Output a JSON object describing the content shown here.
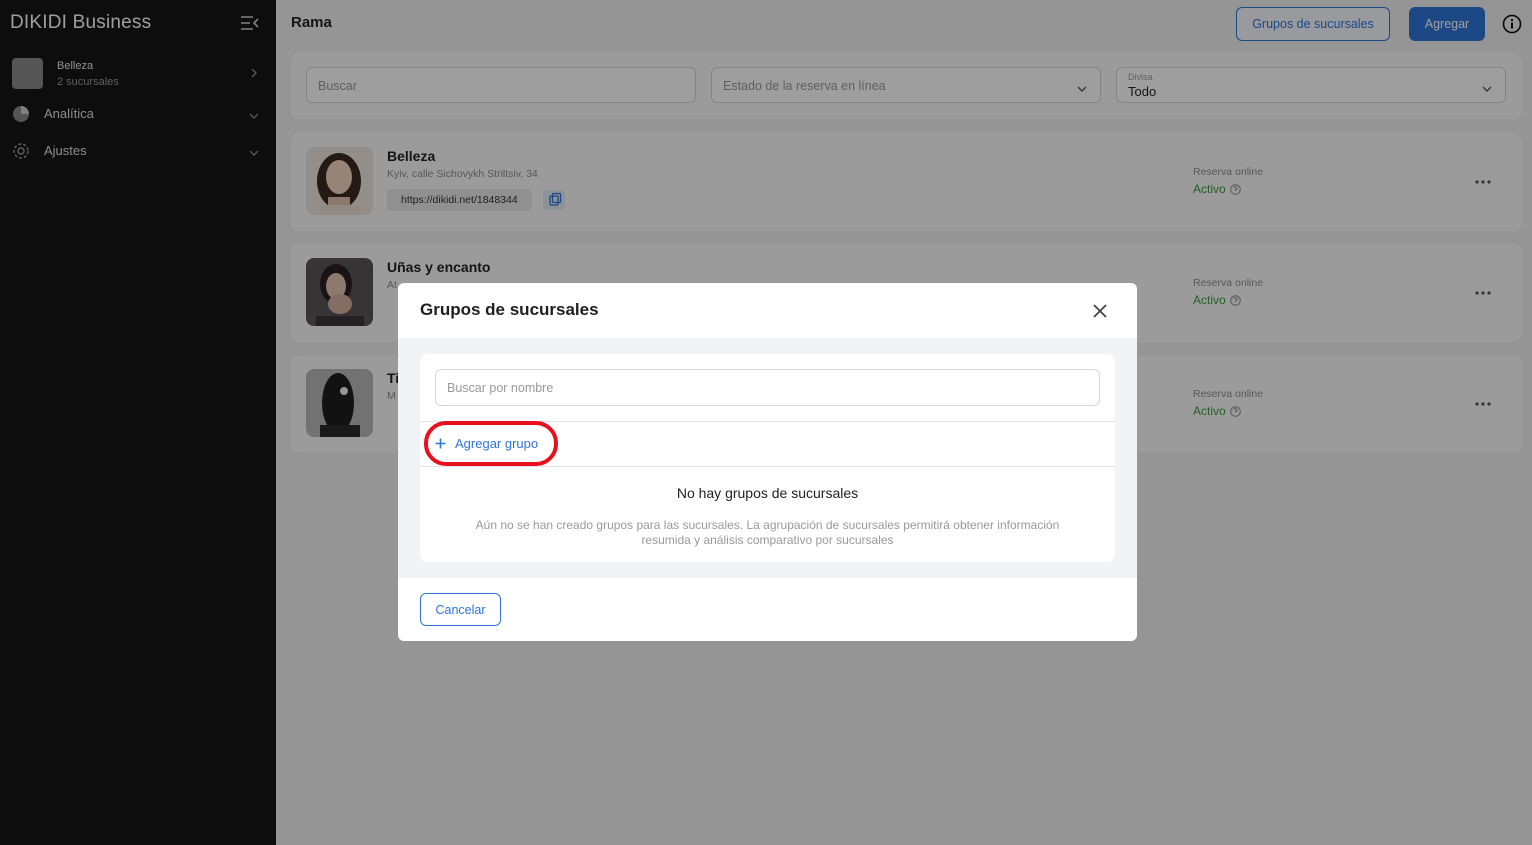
{
  "sidebar": {
    "brand": "DIKIDI Business",
    "company": {
      "name": "Belleza",
      "subtitle": "2 sucursales"
    },
    "nav": [
      {
        "label": "Analítica",
        "icon": "pie-chart-icon"
      },
      {
        "label": "Ajustes",
        "icon": "gear-icon"
      }
    ]
  },
  "header": {
    "title": "Rama",
    "groups_button": "Grupos de sucursales",
    "add_button": "Agregar"
  },
  "filters": {
    "search_placeholder": "Buscar",
    "booking_status_placeholder": "Estado de la reserva en línea",
    "currency_label": "Divisa",
    "currency_value": "Todo"
  },
  "branches": [
    {
      "name": "Belleza",
      "address": "Kyiv, calle Sichovykh Striltsiv, 34",
      "link": "https://dikidi.net/1848344",
      "rs_label": "Reserva online",
      "rs_value": "Activo"
    },
    {
      "name": "Uñas y encanto",
      "address": "At",
      "rs_label": "Reserva online",
      "rs_value": "Activo"
    },
    {
      "name": "Ti",
      "address": "M",
      "rs_label": "Reserva online",
      "rs_value": "Activo"
    }
  ],
  "modal": {
    "title": "Grupos de sucursales",
    "search_placeholder": "Buscar por nombre",
    "add_group": "Agregar grupo",
    "empty_title": "No hay grupos de sucursales",
    "empty_desc": "Aún no se han creado grupos para las sucursales. La agrupación de sucursales permitirá obtener información resumida y análisis comparativo por sucursales",
    "cancel": "Cancelar"
  },
  "colors": {
    "accent": "#2f74d9",
    "active_status": "#3b9b3f",
    "highlight": "#e8101b",
    "sidebar_bg": "#161616"
  }
}
